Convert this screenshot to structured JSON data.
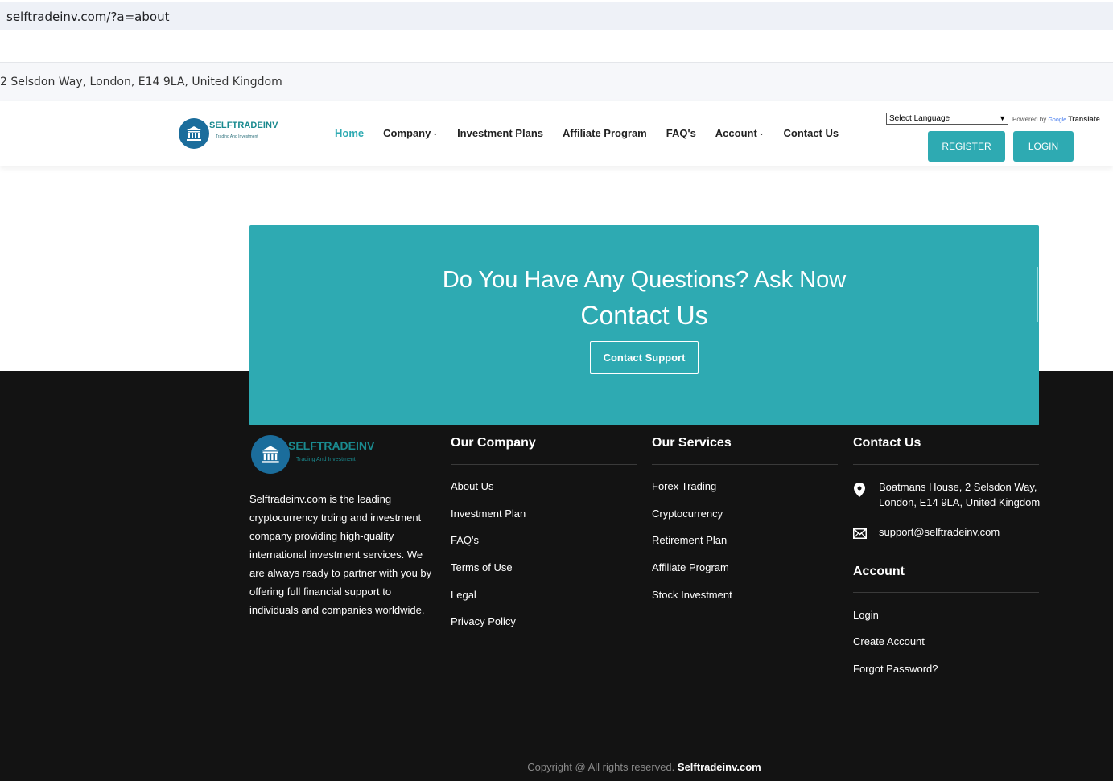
{
  "browser": {
    "url": "selftradeinv.com/?a=about"
  },
  "topbar": {
    "address": "2 Selsdon Way, London, E14 9LA, United Kingdom"
  },
  "brand": {
    "name": "SELFTRADEINV",
    "tagline": "Trading And Investment",
    "color": "#1a8a8f"
  },
  "nav": {
    "items": [
      {
        "label": "Home",
        "active": true,
        "dropdown": false
      },
      {
        "label": "Company",
        "active": false,
        "dropdown": true
      },
      {
        "label": "Investment Plans",
        "active": false,
        "dropdown": false
      },
      {
        "label": "Affiliate Program",
        "active": false,
        "dropdown": false
      },
      {
        "label": "FAQ's",
        "active": false,
        "dropdown": false
      },
      {
        "label": "Account",
        "active": false,
        "dropdown": true
      },
      {
        "label": "Contact Us",
        "active": false,
        "dropdown": false
      }
    ],
    "language_select": "Select Language",
    "powered_by": "Powered by",
    "google": "Google",
    "translate": "Translate",
    "register": "REGISTER",
    "login": "LOGIN"
  },
  "cta": {
    "question": "Do You Have Any Questions? Ask Now",
    "contact": "Contact Us",
    "button": "Contact Support",
    "accent": "#2eaab2"
  },
  "footer": {
    "about": "Selftradeinv.com is the leading cryptocurrency trding and investment company providing high-quality international investment services. We are always ready to partner with you by offering full financial support to individuals and companies worldwide.",
    "company": {
      "title": "Our Company",
      "links": [
        "About Us",
        "Investment Plan",
        "FAQ's",
        "Terms of Use",
        "Legal",
        "Privacy Policy"
      ]
    },
    "services": {
      "title": "Our Services",
      "links": [
        "Forex Trading",
        "Cryptocurrency",
        "Retirement Plan",
        "Affiliate Program",
        "Stock Investment"
      ]
    },
    "contact": {
      "title": "Contact Us",
      "address_line1": "Boatmans House, 2 Selsdon Way,",
      "address_line2": "London, E14 9LA, United Kingdom",
      "email": "support@selftradeinv.com"
    },
    "account": {
      "title": "Account",
      "links": [
        "Login",
        "Create Account",
        "Forgot Password?"
      ]
    },
    "copyright": "Copyright @ All rights reserved.",
    "copyright_brand": "Selftradeinv.com"
  }
}
